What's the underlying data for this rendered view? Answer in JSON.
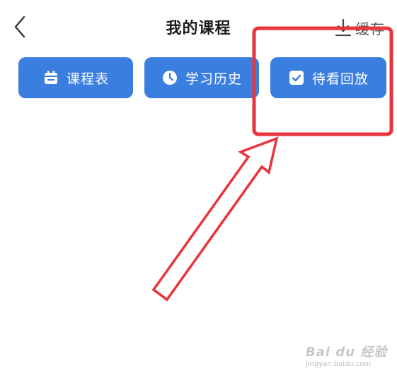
{
  "header": {
    "title": "我的课程",
    "back_icon": "chevron-left-icon",
    "cache": {
      "label": "缓存",
      "icon": "download-icon"
    }
  },
  "actions": [
    {
      "label": "课程表",
      "icon": "calendar-icon"
    },
    {
      "label": "学习历史",
      "icon": "clock-icon"
    },
    {
      "label": "待看回放",
      "icon": "checkbox-icon"
    }
  ],
  "colors": {
    "button_bg": "#3a7ee0",
    "annotation_red": "#e8343c",
    "title_text": "#1c1c1c"
  },
  "annotation": {
    "highlight": "待看回放",
    "shape": "red rectangle with arrow"
  },
  "watermark": {
    "main": "Bai du 经验",
    "sub": "jingyan.baidu.com"
  }
}
